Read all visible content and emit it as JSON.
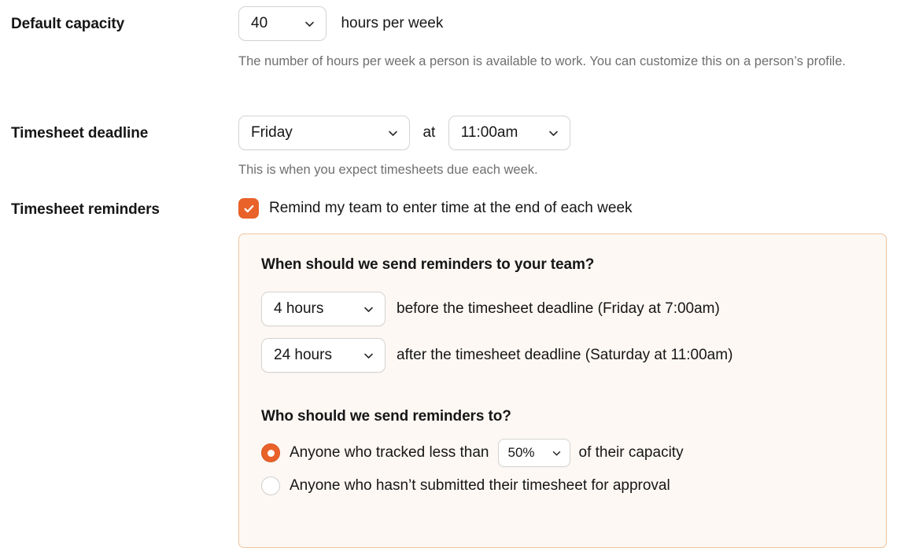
{
  "colors": {
    "accent": "#e8622a",
    "panel_bg": "#fdf8f4",
    "panel_border": "#efc49f",
    "field_border": "#d4d4d2",
    "text": "#161616",
    "muted_text": "#6f6f6f"
  },
  "rows": {
    "capacity": {
      "label": "Default capacity",
      "select_value": "40",
      "suffix": "hours per week",
      "help": "The number of hours per week a person is available to work. You can customize this on a person’s profile."
    },
    "deadline": {
      "label": "Timesheet deadline",
      "day_value": "Friday",
      "conjunction": "at",
      "time_value": "11:00am",
      "help": "This is when you expect timesheets due each week."
    },
    "reminders": {
      "label": "Timesheet reminders",
      "checkbox_checked": true,
      "checkbox_label": "Remind my team to enter time at the end of each week"
    }
  },
  "panel": {
    "when_heading": "When should we send reminders to your team?",
    "before": {
      "select_value": "4 hours",
      "text": "before the timesheet deadline (Friday at 7:00am)"
    },
    "after": {
      "select_value": "24 hours",
      "text": "after the timesheet deadline (Saturday at 11:00am)"
    },
    "who_heading": "Who should we send reminders to?",
    "option_tracked": {
      "selected": true,
      "text_before": "Anyone who tracked less than",
      "percent_value": "50%",
      "text_after": "of their capacity"
    },
    "option_unsubmitted": {
      "selected": false,
      "text": "Anyone who hasn’t submitted their timesheet for approval"
    }
  },
  "icons": {
    "chevron_down": "chevron-down-icon",
    "check": "check-icon"
  }
}
